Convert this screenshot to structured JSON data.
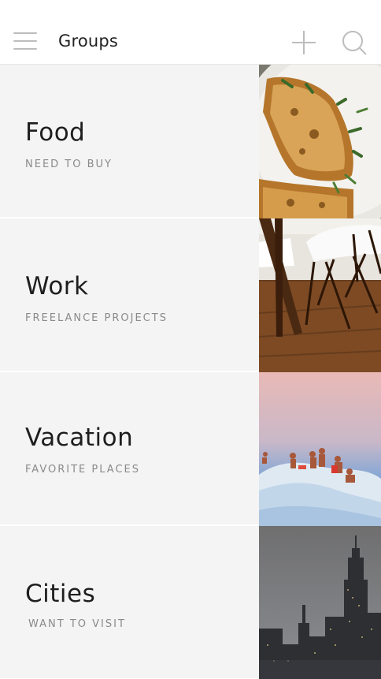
{
  "header": {
    "title": "Groups",
    "icons": {
      "menu": "hamburger-menu-icon",
      "add": "plus-icon",
      "search": "search-icon"
    }
  },
  "groups": [
    {
      "name": "Food",
      "subtitle": "NEED TO BUY",
      "image": "food-photo"
    },
    {
      "name": "Work",
      "subtitle": "FREELANCE PROJECTS",
      "image": "chairs-photo"
    },
    {
      "name": "Vacation",
      "subtitle": "FAVORITE PLACES",
      "image": "beach-rock-photo"
    },
    {
      "name": "Cities",
      "subtitle": "WANT TO VISIT",
      "image": "city-skyline-photo"
    }
  ],
  "colors": {
    "card_background": "#f4f4f4",
    "header_background": "#ffffff",
    "icon_gray": "#bdbdbd"
  }
}
